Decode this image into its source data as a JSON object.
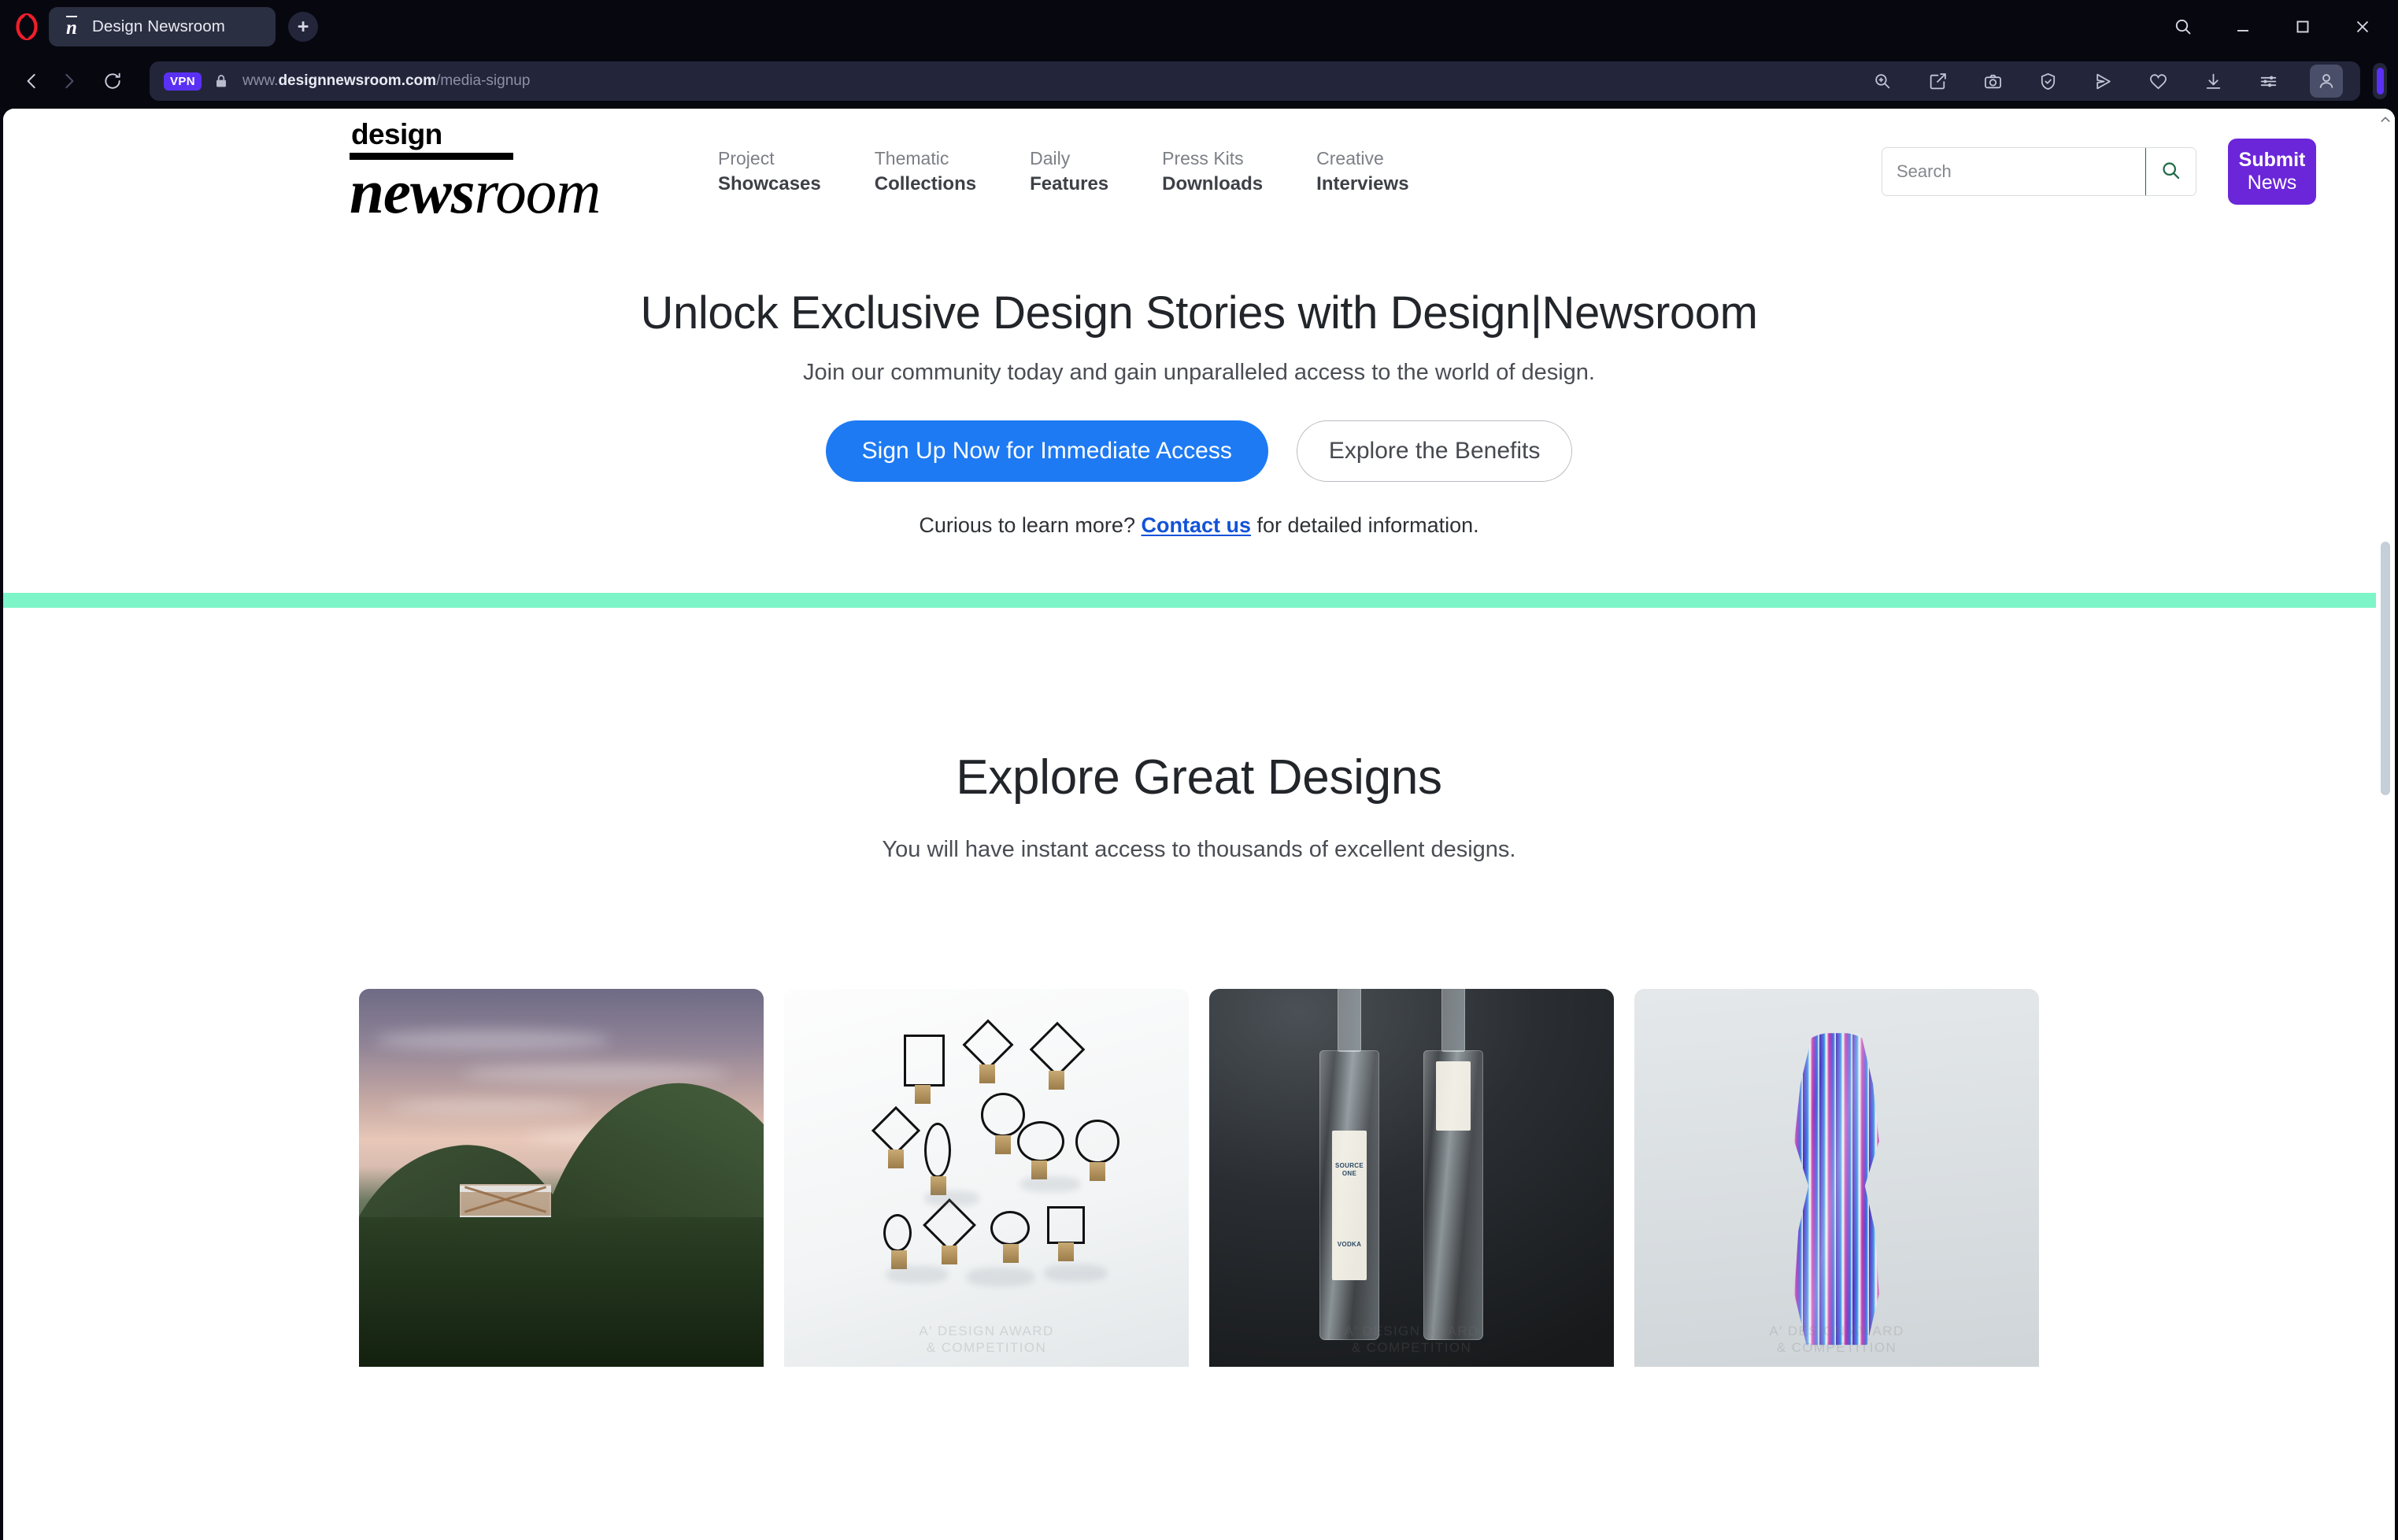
{
  "browser": {
    "name": "Opera",
    "tab": {
      "title": "Design Newsroom",
      "favicon": "n-overline-icon"
    },
    "new_tab_label": "+",
    "window_controls": [
      {
        "name": "search-icon",
        "label": ""
      },
      {
        "name": "minimize-icon",
        "label": ""
      },
      {
        "name": "maximize-icon",
        "label": ""
      },
      {
        "name": "close-icon",
        "label": ""
      }
    ],
    "address": {
      "back_icon": "back-arrow-icon",
      "forward_icon": "forward-arrow-icon",
      "reload_icon": "reload-icon",
      "vpn_badge": "VPN",
      "lock_icon": "padlock-icon",
      "url_scheme": "www.",
      "url_domain": "designnewsroom.com",
      "url_path": "/media-signup",
      "url_full": "www.designnewsroom.com/media-signup"
    },
    "toolbar_icons": [
      "zoom-in-icon",
      "snapshot-edit-icon",
      "camera-icon",
      "shield-check-icon",
      "send-icon",
      "heart-icon",
      "download-icon",
      "sliders-icon",
      "profile-icon"
    ]
  },
  "site": {
    "logo": {
      "top": "design",
      "bold": "news",
      "light": "room"
    },
    "nav": [
      {
        "top": "Project",
        "bottom": "Showcases"
      },
      {
        "top": "Thematic",
        "bottom": "Collections"
      },
      {
        "top": "Daily",
        "bottom": "Features"
      },
      {
        "top": "Press Kits",
        "bottom": "Downloads"
      },
      {
        "top": "Creative",
        "bottom": "Interviews"
      }
    ],
    "search": {
      "placeholder": "Search",
      "value": "",
      "button_icon": "search-icon"
    },
    "submit_button": {
      "line1": "Submit",
      "line2": "News"
    }
  },
  "hero": {
    "heading": "Unlock Exclusive Design Stories with Design|Newsroom",
    "subheading": "Join our community today and gain unparalleled access to the world of design.",
    "primary_cta": "Sign Up Now for Immediate Access",
    "secondary_cta": "Explore the Benefits",
    "note_before": "Curious to learn more?",
    "note_link": "Contact us",
    "note_after": "for detailed information."
  },
  "explore": {
    "heading": "Explore Great Designs",
    "subheading": "You will have instant access to thousands of excellent designs.",
    "cards": [
      {
        "name": "architecture-observation-tower",
        "watermark": ""
      },
      {
        "name": "wireframe-geometric-sculptures",
        "watermark": "A' DESIGN AWARD\n& COMPETITION"
      },
      {
        "name": "source-one-vodka-bottles",
        "watermark": "A' DESIGN AWARD\n& COMPETITION",
        "label_brand": "SOURCE\nONE",
        "label_product": "VODKA"
      },
      {
        "name": "striped-glass-vase",
        "watermark": "A' DESIGN AWARD\n& COMPETITION"
      }
    ]
  },
  "colors": {
    "chrome_bg": "#07080F",
    "tab_bg": "#2B2F42",
    "urlbox_bg": "#23263A",
    "vpn_purple": "#5A30F5",
    "submit_purple": "#6B26D9",
    "primary_blue": "#1D7AF3",
    "link_blue": "#1352D8",
    "search_green": "#1F6B48",
    "divider_mint": "#7DF5C9",
    "heading_dark": "#22252A"
  }
}
